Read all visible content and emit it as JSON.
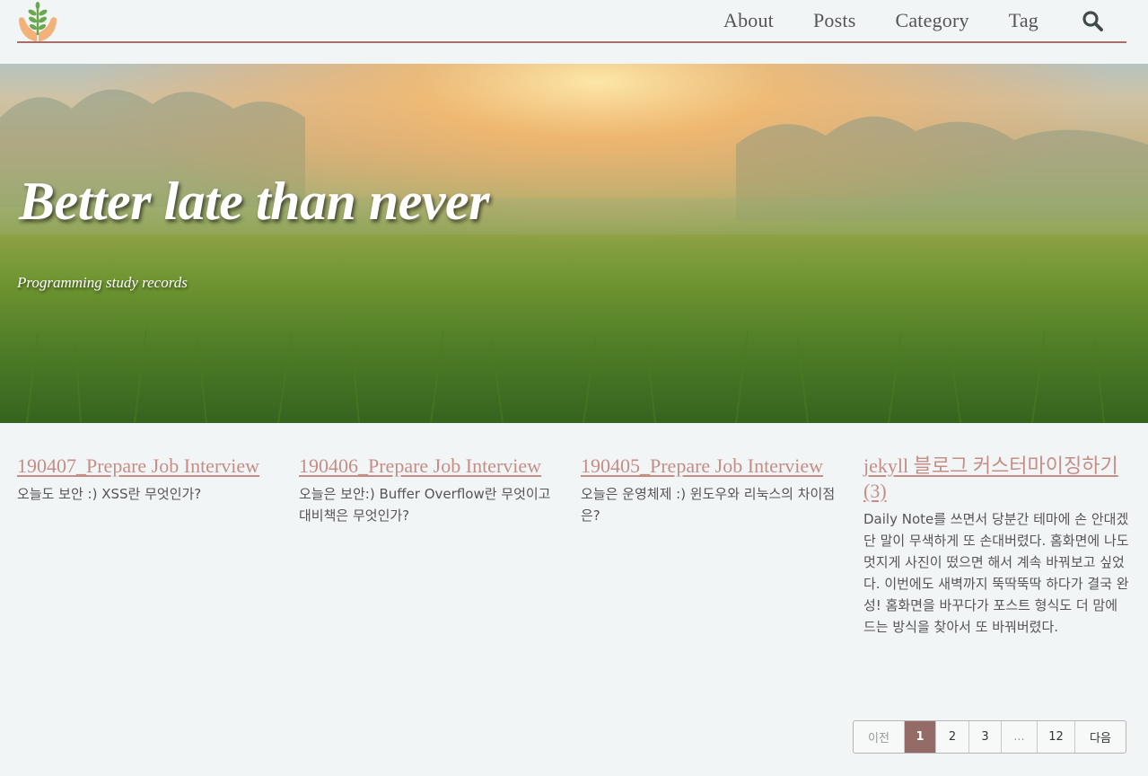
{
  "header": {
    "logo_icon": "hands-sprout-logo",
    "nav": [
      {
        "label": "About"
      },
      {
        "label": "Posts"
      },
      {
        "label": "Category"
      },
      {
        "label": "Tag"
      }
    ],
    "search_icon": "search-icon",
    "accent_color": "#a86d66"
  },
  "hero": {
    "title": "Better late than never",
    "subtitle": "Programming study records"
  },
  "posts": [
    {
      "title": "190407_Prepare Job Interview",
      "excerpt": "오늘도 보안 :) XSS란 무엇인가?"
    },
    {
      "title": "190406_Prepare Job Interview",
      "excerpt": "오늘은 보안:) Buffer Overflow란 무엇이고 대비책은 무엇인가?"
    },
    {
      "title": "190405_Prepare Job Interview",
      "excerpt": "오늘은 운영체제 :) 윈도우와 리눅스의 차이점은?"
    },
    {
      "title": "jekyll 블로그 커스터마이징하기(3)",
      "excerpt": "Daily Note를 쓰면서 당분간 테마에 손 안대겠단 말이 무색하게 또 손대버렸다. 홈화면에 나도 멋지게 사진이 떴으면 해서 계속 바꿔보고 싶었다. 이번에도 새벽까지 뚝딱뚝딱 하다가 결국 완성! 홈화면을 바꾸다가 포스트 형식도 더 맘에 드는 방식을 찾아서 또 바꿔버렸다."
    }
  ],
  "pagination": {
    "prev": "이전",
    "pages": [
      "1",
      "2",
      "3",
      "...",
      "12"
    ],
    "current": "1",
    "next": "다음"
  },
  "colors": {
    "link": "#c48e87",
    "active_page": "#946b67",
    "background": "#f2f5f6"
  }
}
